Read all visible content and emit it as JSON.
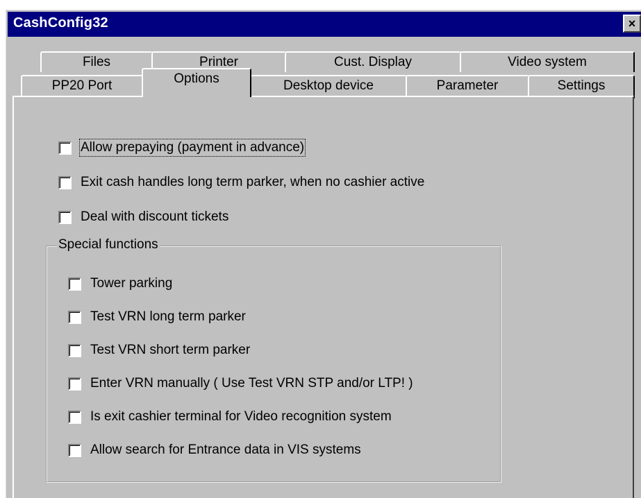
{
  "window": {
    "title": "CashConfig32",
    "close_label": "×"
  },
  "tabs_row1": [
    {
      "label": "Files"
    },
    {
      "label": "Printer"
    },
    {
      "label": "Cust. Display"
    },
    {
      "label": "Video system"
    }
  ],
  "tabs_row2": [
    {
      "label": "PP20 Port"
    },
    {
      "label": "Options",
      "active": true
    },
    {
      "label": "Desktop device"
    },
    {
      "label": "Parameter"
    },
    {
      "label": "Settings"
    }
  ],
  "options": {
    "allow_prepaying": {
      "label": "Allow prepaying (payment in advance)",
      "checked": false
    },
    "exit_cash_long_term": {
      "label": "Exit cash handles long term parker, when no cashier active",
      "checked": false
    },
    "discount_tickets": {
      "label": "Deal with discount tickets",
      "checked": false
    }
  },
  "special_functions": {
    "legend": "Special functions",
    "items": [
      {
        "label": "Tower parking",
        "checked": false
      },
      {
        "label": "Test VRN long term parker",
        "checked": false
      },
      {
        "label": "Test VRN short term parker",
        "checked": false
      },
      {
        "label": "Enter VRN manually ( Use Test VRN STP and/or LTP! )",
        "checked": false
      },
      {
        "label": "Is exit cashier terminal for Video recognition system",
        "checked": false
      },
      {
        "label": "Allow search for Entrance data in VIS systems",
        "checked": false
      }
    ]
  },
  "colors": {
    "titlebar": "#000080",
    "face": "#c0c0c0"
  }
}
